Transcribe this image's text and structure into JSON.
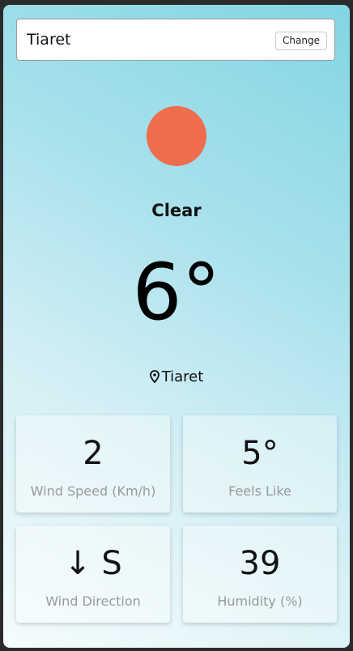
{
  "search": {
    "value": "Tiaret",
    "change_label": "Change"
  },
  "weather": {
    "icon": "sun-icon",
    "icon_color": "#ef6c4c",
    "condition": "Clear",
    "temperature": "6°",
    "location": "Tiaret"
  },
  "stats": [
    {
      "value": "2",
      "label": "Wind Speed (Km/h)"
    },
    {
      "value": "5°",
      "label": "Feels Like"
    },
    {
      "value": "↓ S",
      "label": "Wind Direction"
    },
    {
      "value": "39",
      "label": "Humidity (%)"
    }
  ]
}
